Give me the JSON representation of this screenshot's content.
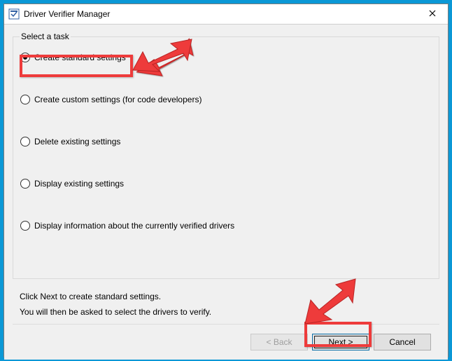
{
  "window": {
    "title": "Driver Verifier Manager"
  },
  "prompt": "Select a task",
  "options": [
    {
      "label": "Create standard settings",
      "selected": true
    },
    {
      "label": "Create custom settings (for code developers)",
      "selected": false
    },
    {
      "label": "Delete existing settings",
      "selected": false
    },
    {
      "label": "Display existing settings",
      "selected": false
    },
    {
      "label": "Display information about the currently verified drivers",
      "selected": false
    }
  ],
  "help": {
    "line1": "Click Next to create standard settings.",
    "line2": "You will then be asked to select the drivers to verify."
  },
  "buttons": {
    "back": "< Back",
    "next": "Next >",
    "cancel": "Cancel"
  },
  "annotation": {
    "color": "#ee3b3b"
  }
}
